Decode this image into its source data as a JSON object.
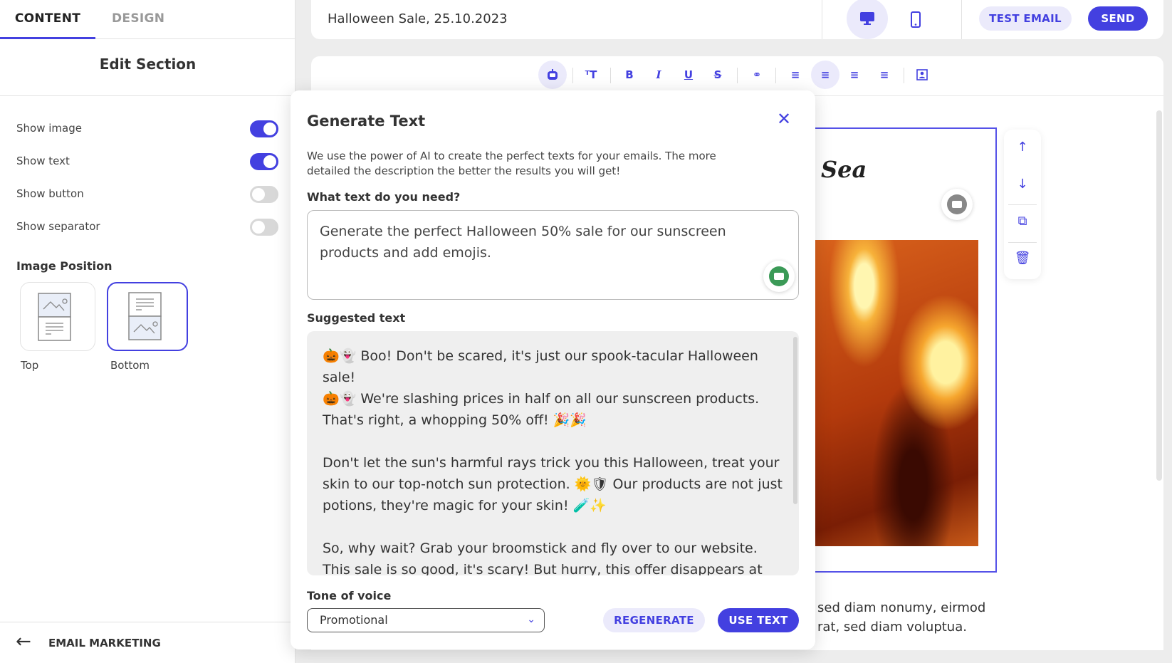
{
  "left": {
    "tabs": [
      {
        "label": "CONTENT",
        "active": true
      },
      {
        "label": "DESIGN",
        "active": false
      }
    ],
    "section_title": "Edit Section",
    "toggles": [
      {
        "label": "Show image",
        "on": true
      },
      {
        "label": "Show text",
        "on": true
      },
      {
        "label": "Show button",
        "on": false
      },
      {
        "label": "Show separator",
        "on": false
      }
    ],
    "image_position": {
      "label": "Image Position",
      "options": [
        {
          "label": "Top",
          "selected": false
        },
        {
          "label": "Bottom",
          "selected": true
        }
      ]
    },
    "back_label": "EMAIL MARKETING"
  },
  "header": {
    "title": "Halloween Sale, 25.10.2023",
    "test_email": "TEST EMAIL",
    "send": "SEND"
  },
  "modal": {
    "title": "Generate Text",
    "description": "We use the power of AI to create the perfect texts for your emails. The more detailed the description the better the results you will get!",
    "prompt_label": "What text do you need?",
    "prompt_value": "Generate the perfect Halloween 50% sale for our sunscreen products and add emojis.",
    "suggested_label": "Suggested text",
    "suggested_text": "🎃👻 Boo! Don't be scared, it's just our spook-tacular Halloween sale!\n🎃👻 We're slashing prices in half on all our sunscreen products. That's right, a whopping 50% off! 🎉🎉\n\nDon't let the sun's harmful rays trick you this Halloween, treat your skin to our top-notch sun protection. 🌞🛡 Our products are not just potions, they're magic for your skin! 🧪✨\n\nSo, why wait? Grab your broomstick and fly over to our website. This sale is so good, it's scary! But hurry, this offer disappears at the stroke of midnight on Halloween! 🕛🦇",
    "tone_label": "Tone of voice",
    "tone_value": "Promotional",
    "regenerate": "REGENERATE",
    "use_text": "USE TEXT"
  },
  "preview": {
    "heading_fragment": "Sea",
    "body_line1": "sed diam nonumy, eirmod",
    "body_line2": "rat, sed diam voluptua."
  },
  "colors": {
    "accent": "#4340e0",
    "accent_light": "#ebeafb"
  }
}
